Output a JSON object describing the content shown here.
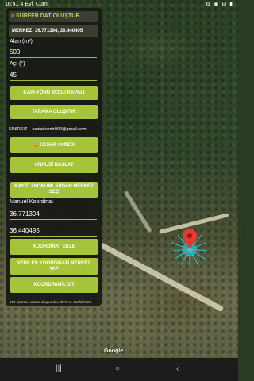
{
  "status_bar": {
    "time": "16:41",
    "date": "4 Eyl, Cum",
    "system_icons": "⚙ ◉ ⊟ ▮"
  },
  "panel": {
    "title": "≡ SURFER DAT OLUŞTUR",
    "coordinates": "MERKEZ: 36.771394, 36.440495",
    "area_label": "Alan (m²)",
    "area_value": "500",
    "angle_label": "Açı (°)",
    "angle_value": "45",
    "button_door_mode": "KAPI-YÖNÜ MODU KAPALI",
    "button_create_scan": "TARAMA OLUŞTUR",
    "account_email": "SINIRSIZ – captainemir002@gmail.com",
    "button_account": "🔒 HESAP / KREDI",
    "button_start_analysis": "ANALİZİ BAŞLAT",
    "button_saved_center": "KAYITLI KONUMLARDAN MERKEZ SEÇ",
    "manual_label": "Manuel Koordinat",
    "manual_lat": "36.771394",
    "manual_lon": "36.440495",
    "button_add_coord": "KOORDİNAT EKLE",
    "button_center_given": "VERİLEN KOORDİNATI MERKEZ YAP",
    "button_go_coord": "KOORDİNATA GİT",
    "footnote": "169 tarama noktası oluşturuldu. DAT ve analiz hazır."
  },
  "map": {
    "attribution": "Google"
  },
  "colors": {
    "accent": "#a6c43a",
    "panel": "#181a14",
    "title_text": "#b8d94a",
    "marker": "#e53935",
    "scan_lines": "#29d4f0"
  }
}
